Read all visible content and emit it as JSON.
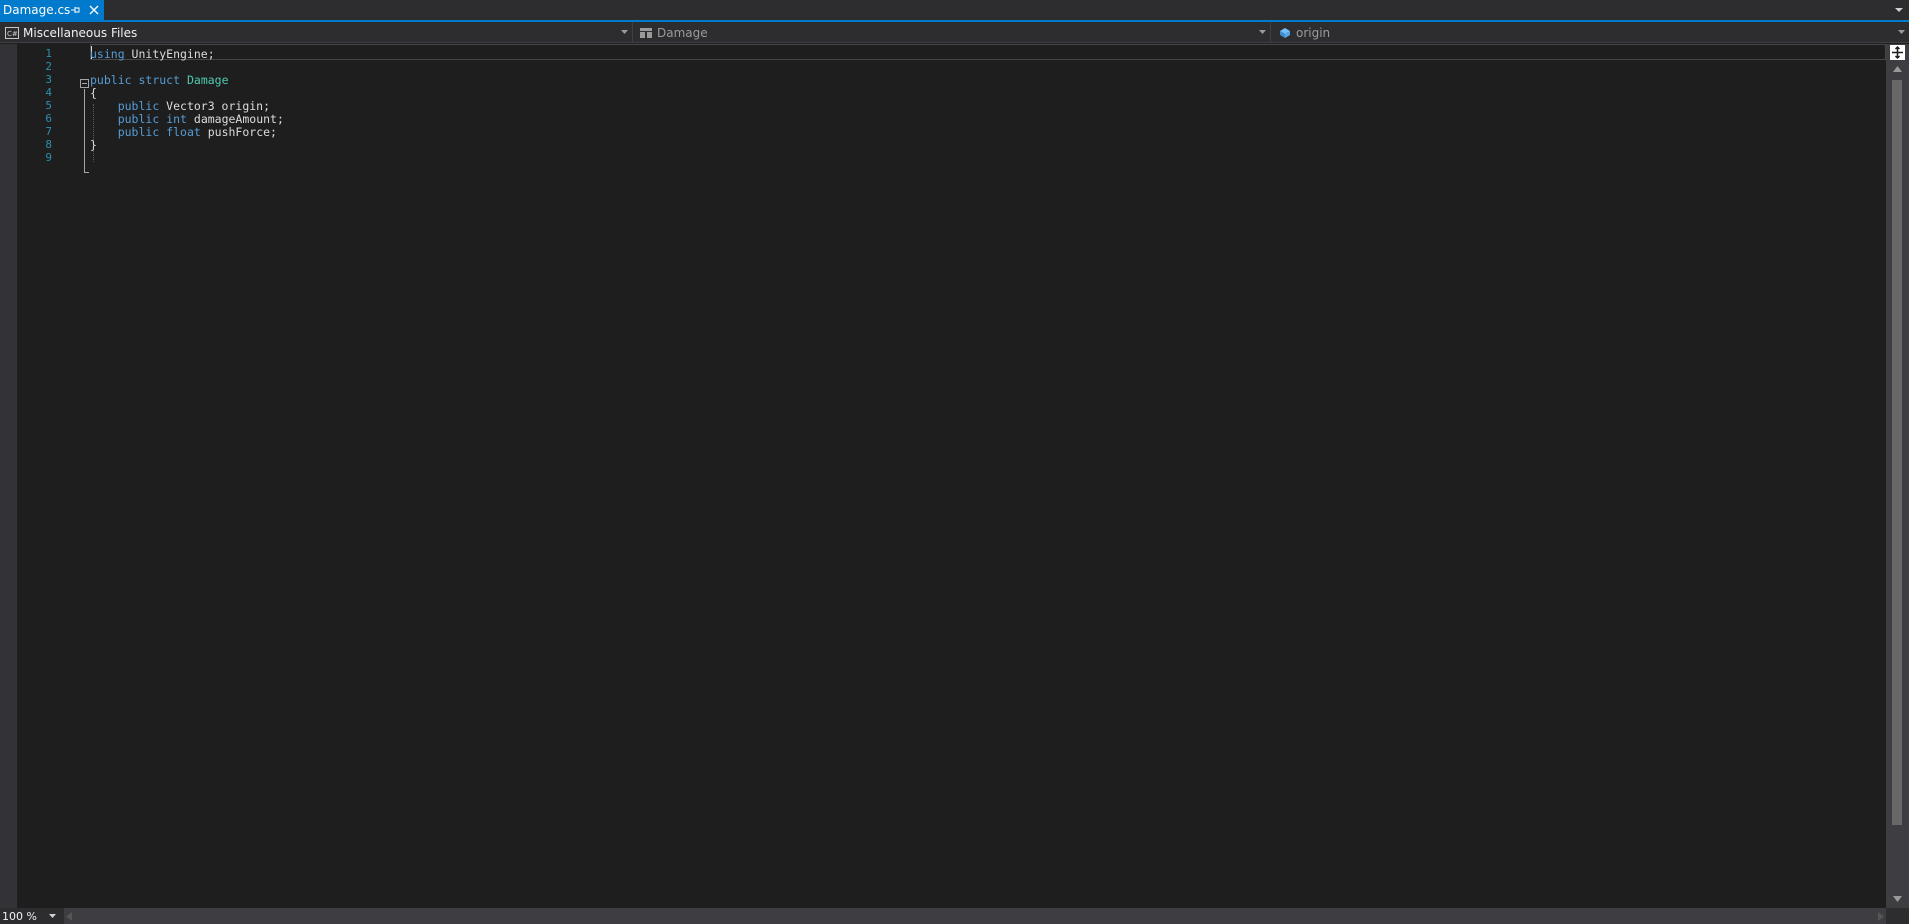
{
  "tab": {
    "title": "Damage.cs",
    "pin_icon": "pin-icon",
    "close_icon": "close-icon",
    "active_color": "#007acc"
  },
  "navbar": {
    "project": {
      "icon": "csharp-project-icon",
      "label": "Miscellaneous Files"
    },
    "type": {
      "icon": "struct-icon",
      "label": "Damage"
    },
    "member": {
      "icon": "field-icon",
      "label": "origin"
    }
  },
  "editor": {
    "line_numbers": [
      "1",
      "2",
      "3",
      "4",
      "5",
      "6",
      "7",
      "8",
      "9"
    ],
    "lines": [
      [
        {
          "text": "using",
          "kind": "keyword"
        },
        {
          "text": " UnityEngine;",
          "kind": "plain"
        }
      ],
      [],
      [
        {
          "text": "public",
          "kind": "keyword"
        },
        {
          "text": " ",
          "kind": "plain"
        },
        {
          "text": "struct",
          "kind": "keyword"
        },
        {
          "text": " ",
          "kind": "plain"
        },
        {
          "text": "Damage",
          "kind": "type"
        }
      ],
      [
        {
          "text": "{",
          "kind": "plain"
        }
      ],
      [
        {
          "text": "    ",
          "kind": "plain"
        },
        {
          "text": "public",
          "kind": "keyword"
        },
        {
          "text": " Vector3 origin;",
          "kind": "plain"
        }
      ],
      [
        {
          "text": "    ",
          "kind": "plain"
        },
        {
          "text": "public",
          "kind": "keyword"
        },
        {
          "text": " ",
          "kind": "plain"
        },
        {
          "text": "int",
          "kind": "keyword"
        },
        {
          "text": " damageAmount;",
          "kind": "plain"
        }
      ],
      [
        {
          "text": "    ",
          "kind": "plain"
        },
        {
          "text": "public",
          "kind": "keyword"
        },
        {
          "text": " ",
          "kind": "plain"
        },
        {
          "text": "float",
          "kind": "keyword"
        },
        {
          "text": " pushForce;",
          "kind": "plain"
        }
      ],
      [
        {
          "text": "}",
          "kind": "plain"
        }
      ],
      []
    ],
    "colors": {
      "keyword": "#569cd6",
      "type": "#4ec9b0",
      "plain": "#dcdcdc",
      "line_number": "#2b91af",
      "background": "#1e1e1e"
    }
  },
  "status": {
    "zoom": "100 %"
  }
}
